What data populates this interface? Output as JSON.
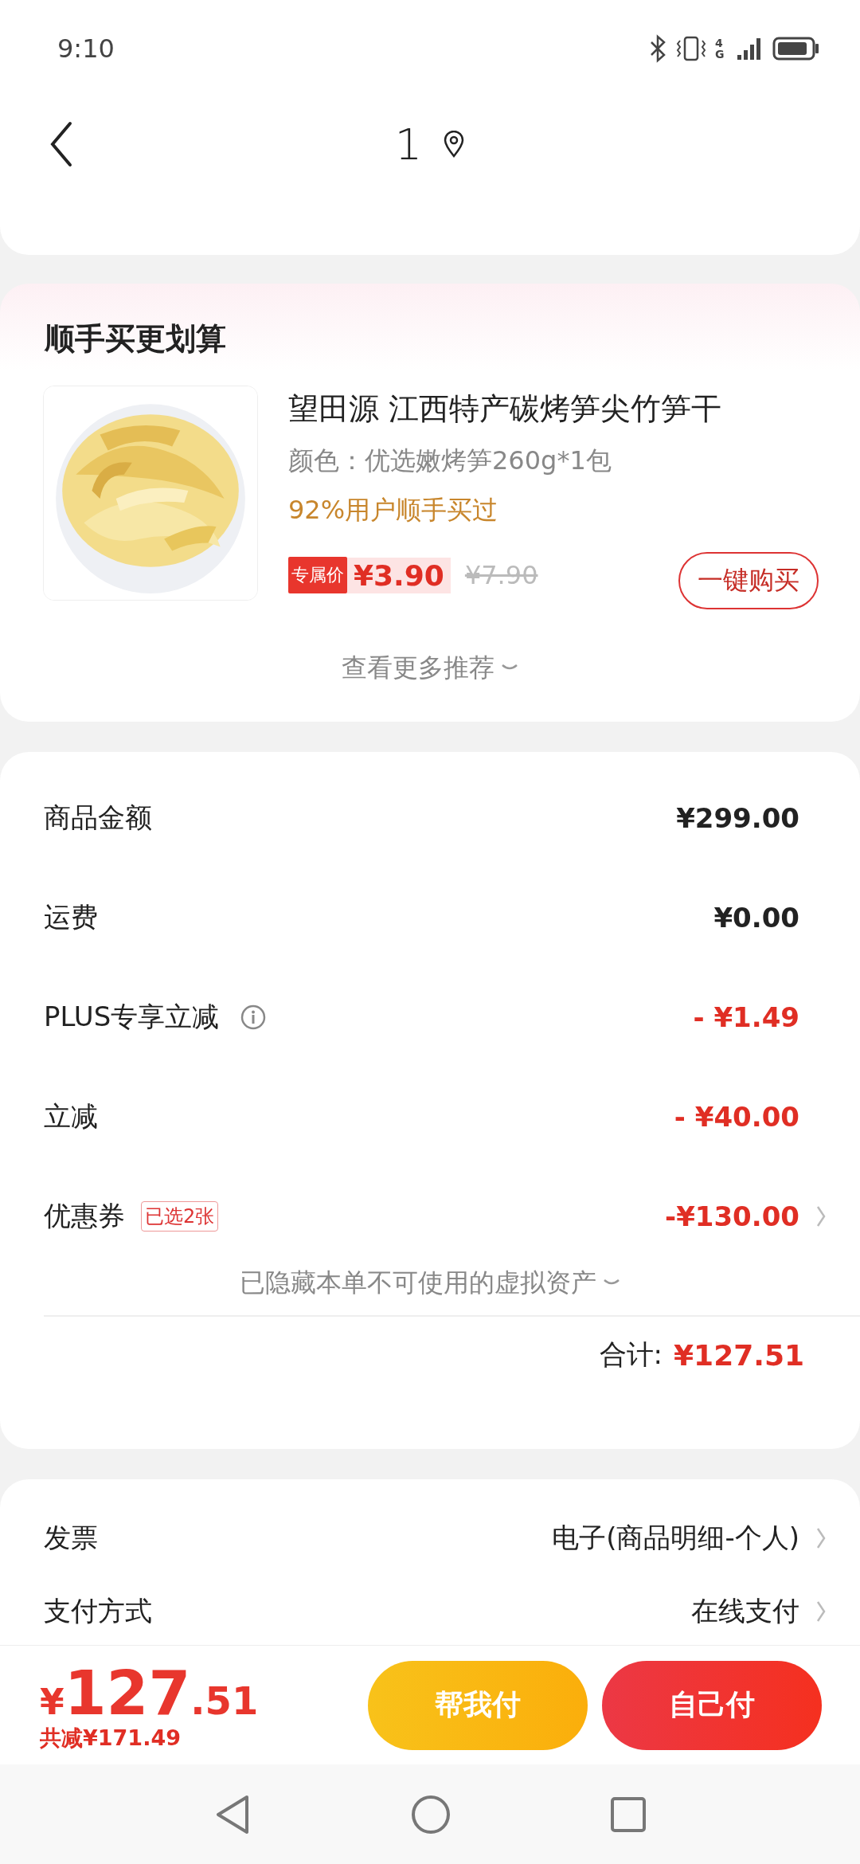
{
  "status_bar": {
    "time": "9:10",
    "network": "4G"
  },
  "header": {
    "title": "1"
  },
  "recommend": {
    "title": "顺手买更划算",
    "product": {
      "name": "望田源 江西特产碳烤笋尖竹笋干",
      "spec": "颜色：优选嫩烤笋260g*1包",
      "note": "92%用户顺手买过",
      "tag": "专属价",
      "price": "¥3.90",
      "original_price": "¥7.90",
      "buy_button": "一键购买"
    },
    "more_link": "查看更多推荐"
  },
  "summary": {
    "rows": [
      {
        "label": "商品金额",
        "value": "¥299.00",
        "highlight": false,
        "info": false,
        "has_arrow": false
      },
      {
        "label": "运费",
        "value": "¥0.00",
        "highlight": false,
        "info": false,
        "has_arrow": false
      },
      {
        "label": "PLUS专享立减",
        "value": "- ¥1.49",
        "highlight": true,
        "info": true,
        "has_arrow": false
      },
      {
        "label": "立减",
        "value": "- ¥40.00",
        "highlight": true,
        "info": false,
        "has_arrow": false
      },
      {
        "label": "优惠券",
        "badge": "已选2张",
        "value": "-¥130.00",
        "highlight": true,
        "info": false,
        "has_arrow": true
      }
    ],
    "hidden_note": "已隐藏本单不可使用的虚拟资产",
    "total_label": "合计:",
    "total_value": "¥127.51"
  },
  "options": {
    "rows": [
      {
        "label": "发票",
        "value": "电子(商品明细-个人)"
      },
      {
        "label": "支付方式",
        "value": "在线支付"
      }
    ]
  },
  "footer": {
    "currency": "¥",
    "amount": "127",
    "decimals": ".51",
    "saved": "共减¥171.49",
    "buttons": [
      {
        "label": "帮我付",
        "kind": "friend"
      },
      {
        "label": "自己付",
        "kind": "self"
      }
    ]
  }
}
